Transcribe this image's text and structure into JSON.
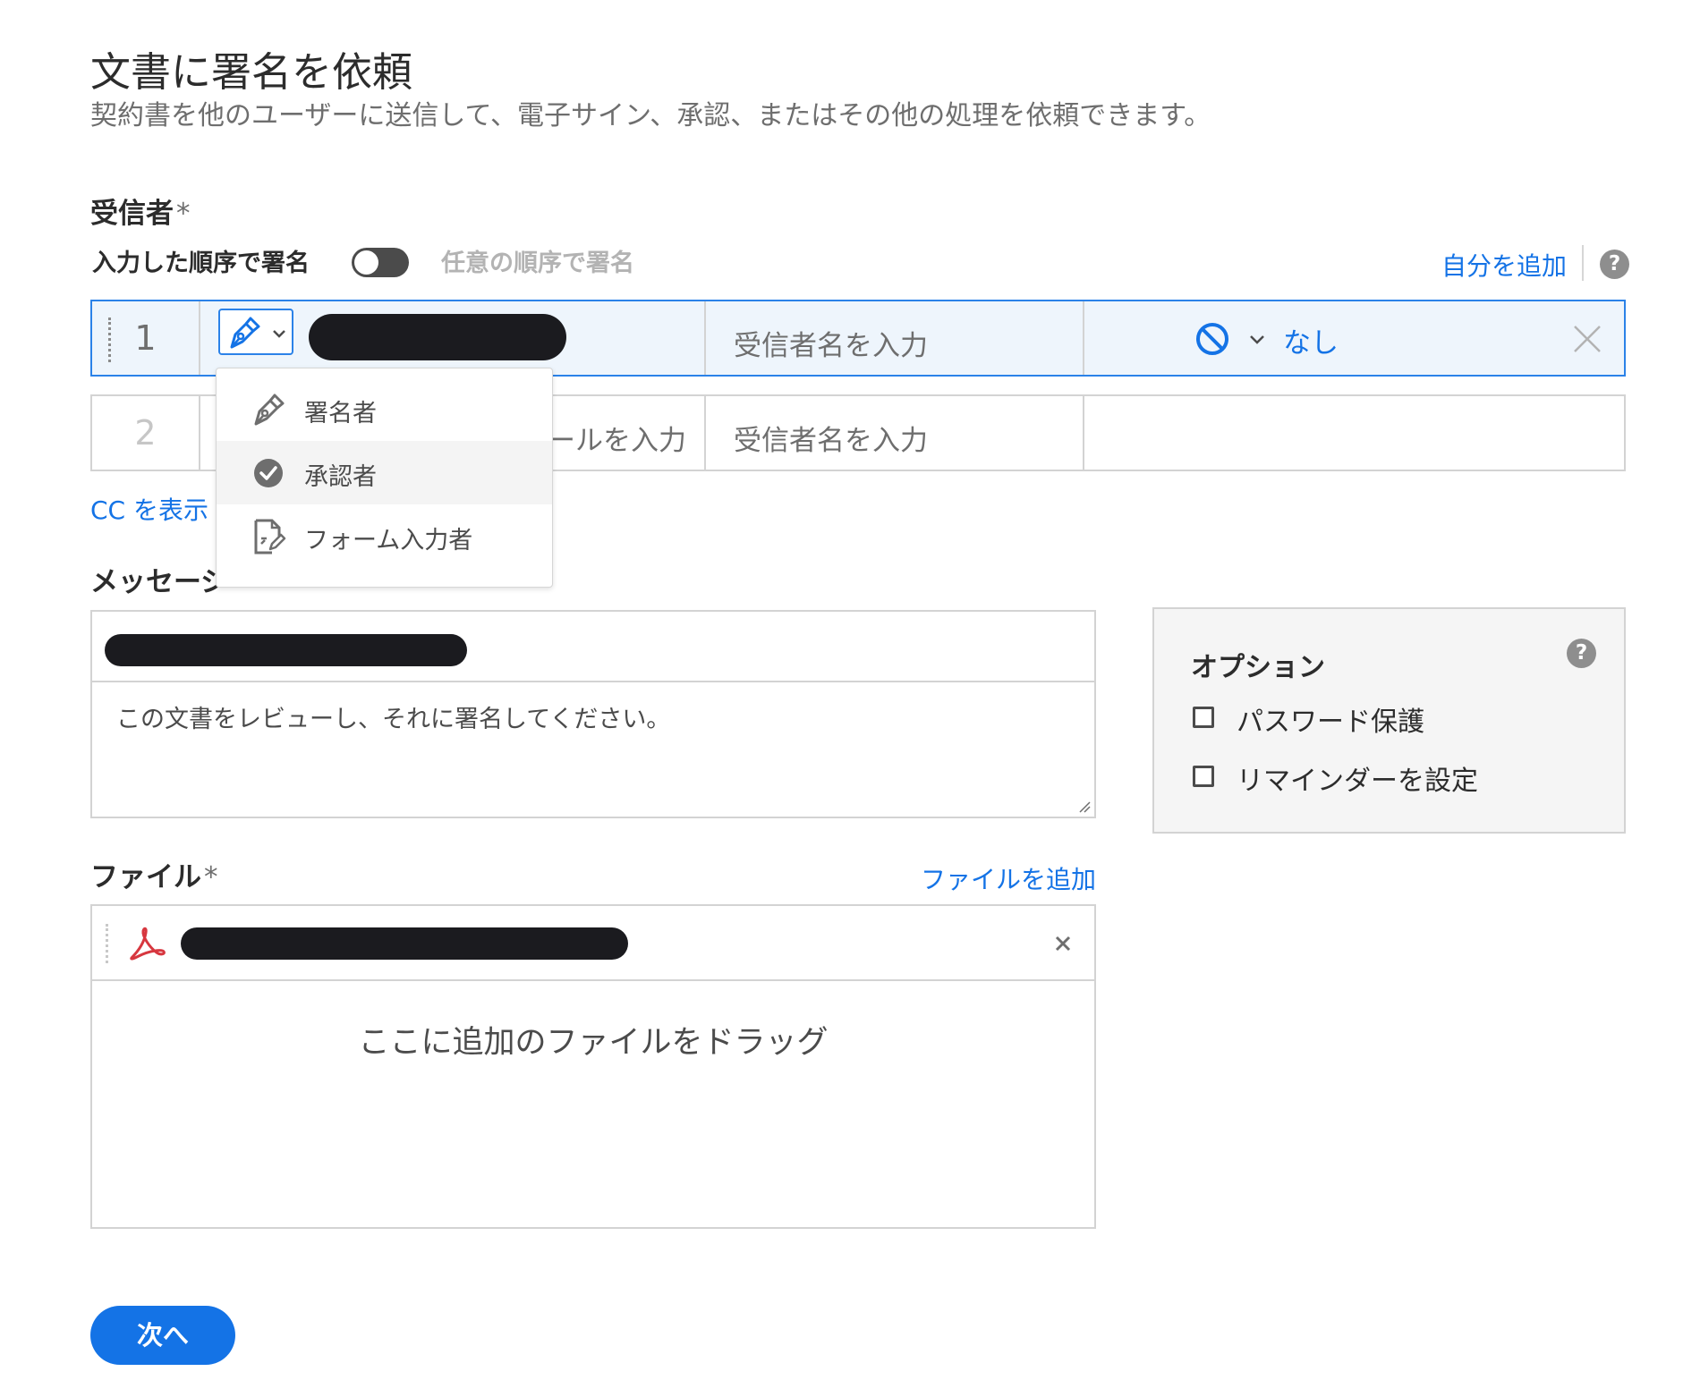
{
  "header": {
    "title": "文書に署名を依頼",
    "subtitle": "契約書を他のユーザーに送信して、電子サイン、承認、またはその他の処理を依頼できます。"
  },
  "recipients": {
    "label": "受信者",
    "required_mark": "*",
    "order_label": "入力した順序で署名",
    "order_toggle_on": false,
    "any_order_label": "任意の順序で署名",
    "add_self": "自分を追加",
    "help_glyph": "?",
    "rows": [
      {
        "number": "1",
        "name_placeholder": "受信者名を入力",
        "auth_label": "なし",
        "role_icon": "pen-icon"
      },
      {
        "number": "2",
        "email_placeholder_partial": "ールを入力",
        "name_placeholder": "受信者名を入力"
      }
    ],
    "role_menu": [
      {
        "label": "署名者",
        "icon": "pen-icon"
      },
      {
        "label": "承認者",
        "icon": "check-circle-icon"
      },
      {
        "label": "フォーム入力者",
        "icon": "form-edit-icon"
      }
    ],
    "cc_link": "CC を表示"
  },
  "message": {
    "label_partial": "メッセージ",
    "body": "この文書をレビューし、それに署名してください。"
  },
  "options": {
    "title": "オプション",
    "help_glyph": "?",
    "items": [
      {
        "label": "パスワード保護",
        "checked": false
      },
      {
        "label": "リマインダーを設定",
        "checked": false
      }
    ]
  },
  "files": {
    "label": "ファイル",
    "required_mark": "*",
    "add_file": "ファイルを追加",
    "remove_glyph": "×",
    "drop_text": "ここに追加のファイルをドラッグ"
  },
  "footer": {
    "next_label": "次へ"
  },
  "colors": {
    "accent": "#1473e6",
    "active_row_bg": "#eef5fc",
    "pdf_red": "#d7373f"
  }
}
